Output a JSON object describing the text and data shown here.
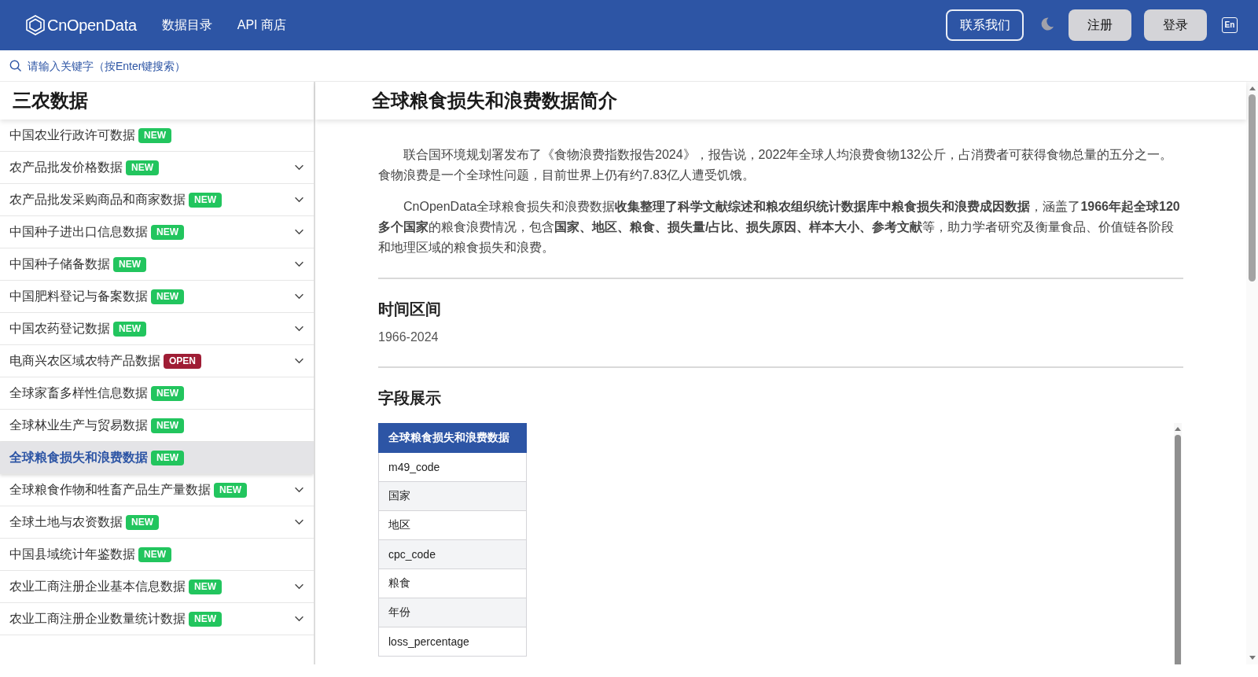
{
  "header": {
    "logo": "CnOpenData",
    "nav": [
      {
        "label": "数据目录"
      },
      {
        "label": "API 商店"
      }
    ],
    "contact_button": "联系我们",
    "register_button": "注册",
    "login_button": "登录",
    "language_button": "En"
  },
  "search": {
    "placeholder": "请输入关键字（按Enter键搜索）"
  },
  "sidebar": {
    "title": "三农数据",
    "items": [
      {
        "label": "中国农业行政许可数据",
        "badge": {
          "text": "NEW",
          "color": "#22c55e"
        },
        "expandable": false,
        "selected": false
      },
      {
        "label": "农产品批发价格数据",
        "badge": {
          "text": "NEW",
          "color": "#22c55e"
        },
        "expandable": true,
        "selected": false
      },
      {
        "label": "农产品批发采购商品和商家数据",
        "badge": {
          "text": "NEW",
          "color": "#22c55e"
        },
        "expandable": true,
        "selected": false
      },
      {
        "label": "中国种子进出口信息数据",
        "badge": {
          "text": "NEW",
          "color": "#22c55e"
        },
        "expandable": true,
        "selected": false
      },
      {
        "label": "中国种子储备数据",
        "badge": {
          "text": "NEW",
          "color": "#22c55e"
        },
        "expandable": true,
        "selected": false
      },
      {
        "label": "中国肥料登记与备案数据",
        "badge": {
          "text": "NEW",
          "color": "#22c55e"
        },
        "expandable": true,
        "selected": false
      },
      {
        "label": "中国农药登记数据",
        "badge": {
          "text": "NEW",
          "color": "#22c55e"
        },
        "expandable": true,
        "selected": false
      },
      {
        "label": "电商兴农区域农特产品数据",
        "badge": {
          "text": "OPEN",
          "color": "#9f1d35"
        },
        "expandable": true,
        "selected": false
      },
      {
        "label": "全球家畜多样性信息数据",
        "badge": {
          "text": "NEW",
          "color": "#22c55e"
        },
        "expandable": false,
        "selected": false
      },
      {
        "label": "全球林业生产与贸易数据",
        "badge": {
          "text": "NEW",
          "color": "#22c55e"
        },
        "expandable": false,
        "selected": false
      },
      {
        "label": "全球粮食损失和浪费数据",
        "badge": {
          "text": "NEW",
          "color": "#22c55e"
        },
        "expandable": false,
        "selected": true
      },
      {
        "label": "全球粮食作物和牲畜产品生产量数据",
        "badge": {
          "text": "NEW",
          "color": "#22c55e"
        },
        "expandable": true,
        "selected": false
      },
      {
        "label": "全球土地与农资数据",
        "badge": {
          "text": "NEW",
          "color": "#22c55e"
        },
        "expandable": true,
        "selected": false
      },
      {
        "label": "中国县域统计年鉴数据",
        "badge": {
          "text": "NEW",
          "color": "#22c55e"
        },
        "expandable": false,
        "selected": false
      },
      {
        "label": "农业工商注册企业基本信息数据",
        "badge": {
          "text": "NEW",
          "color": "#22c55e"
        },
        "expandable": true,
        "selected": false
      },
      {
        "label": "农业工商注册企业数量统计数据",
        "badge": {
          "text": "NEW",
          "color": "#22c55e"
        },
        "expandable": true,
        "selected": false
      }
    ]
  },
  "main": {
    "title": "全球粮食损失和浪费数据简介",
    "paragraphs": [
      "联合国环境规划署发布了《食物浪费指数报告2024》，报告说，2022年全球人均浪费食物132公斤，占消费者可获得食物总量的五分之一。食物浪费是一个全球性问题，目前世界上仍有约7.83亿人遭受饥饿。",
      "CnOpenData全球粮食损失和浪费数据**收集整理了科学文献综述和粮农组织统计数据库中粮食损失和浪费成因数据**，涵盖了**1966年起全球120多个国家**的粮食浪费情况，包含**国家、地区、粮食、损失量/占比、损失原因、样本大小、参考文献**等，助力学者研究及衡量食品、价值链各阶段和地理区域的粮食损失和浪费。"
    ],
    "sections": [
      {
        "kind": "text",
        "heading": "时间区间",
        "text": "1966-2024"
      },
      {
        "kind": "table",
        "heading": "字段展示",
        "table": {
          "columns": [
            "全球粮食损失和浪费数据"
          ],
          "rows": [
            "m49_code",
            "国家",
            "地区",
            "cpc_code",
            "粮食",
            "年份",
            "loss_percentage"
          ]
        }
      }
    ]
  }
}
